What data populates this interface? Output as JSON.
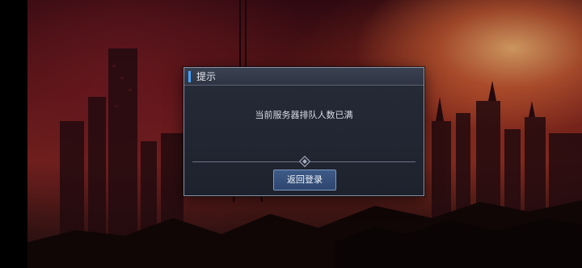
{
  "dialog": {
    "title": "提示",
    "message": "当前服务器排队人数已满",
    "button_label": "返回登录"
  },
  "colors": {
    "accent": "#4aa3ff",
    "dialog_bg": "#262b38",
    "button_bg": "#3d5a86",
    "sky_glow": "#e86e3c"
  }
}
